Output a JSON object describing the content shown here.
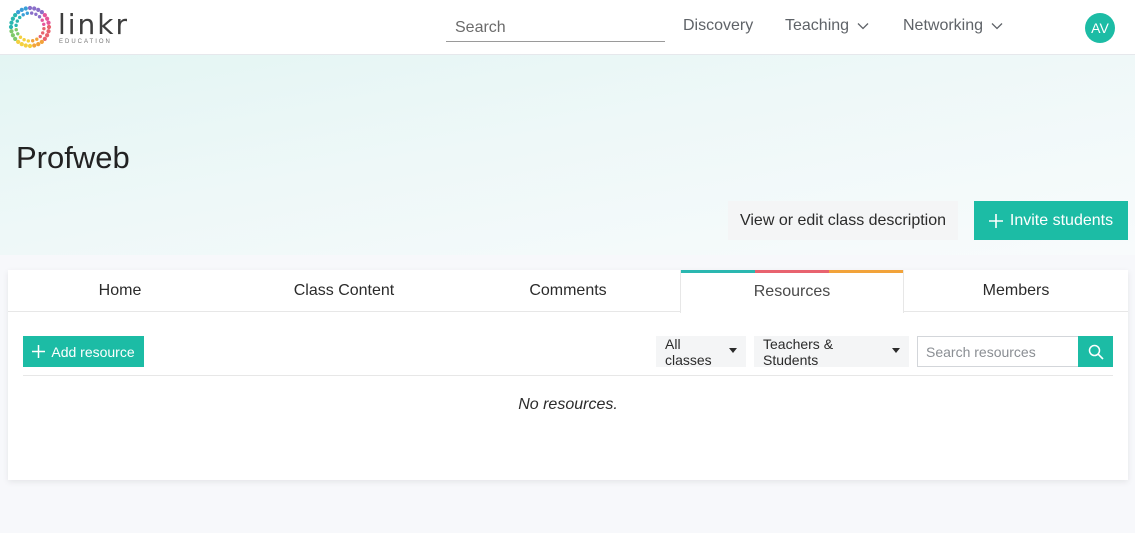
{
  "brand": {
    "name": "linkr",
    "subtitle": "EDUCATION"
  },
  "nav": {
    "search_placeholder": "Search",
    "items": [
      {
        "label": "Discovery"
      },
      {
        "label": "Teaching"
      },
      {
        "label": "Networking"
      }
    ],
    "avatar_initials": "AV"
  },
  "header": {
    "class_title": "Profweb",
    "desc_button": "View or edit class description",
    "invite_button": "Invite students"
  },
  "tabs": [
    {
      "label": "Home"
    },
    {
      "label": "Class Content"
    },
    {
      "label": "Comments"
    },
    {
      "label": "Resources",
      "active": true
    },
    {
      "label": "Members"
    }
  ],
  "toolbar": {
    "add_resource": "Add resource",
    "filter_classes": "All classes",
    "filter_audience": "Teachers & Students",
    "search_placeholder": "Search resources"
  },
  "empty_message": "No resources.",
  "colors": {
    "accent": "#1cbca5",
    "tab_accent": [
      "#2ab7b0",
      "#e8636f",
      "#f2a33a"
    ]
  }
}
